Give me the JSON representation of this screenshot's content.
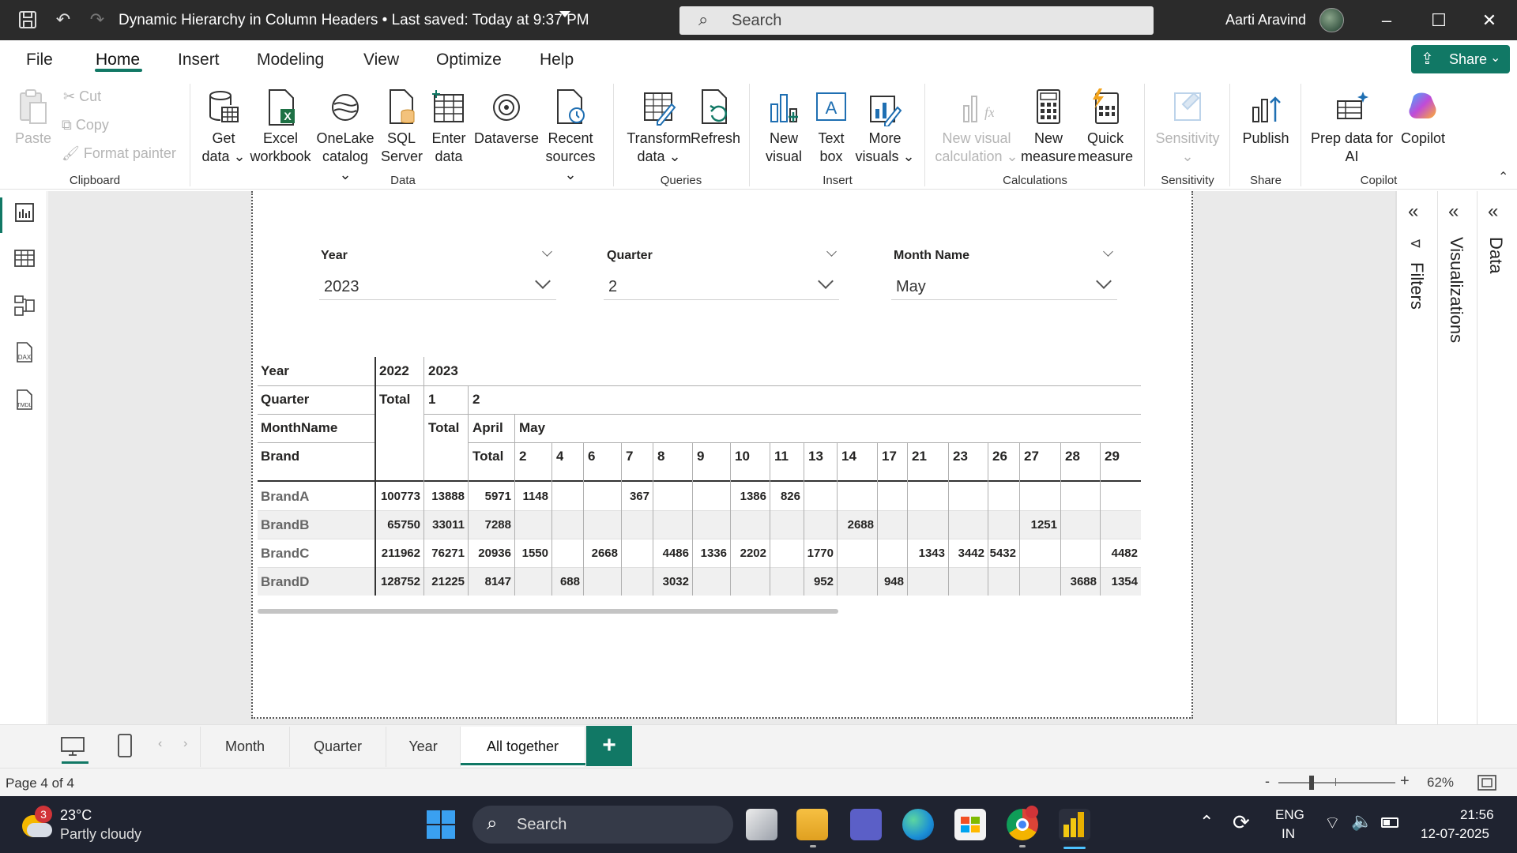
{
  "titlebar": {
    "doc_title": "Dynamic Hierarchy in Column Headers • Last saved: Today at 9:37 PM",
    "search_placeholder": "Search",
    "user_name": "Aarti Aravind"
  },
  "menu": {
    "items": [
      "File",
      "Home",
      "Insert",
      "Modeling",
      "View",
      "Optimize",
      "Help"
    ],
    "active": "Home",
    "share_label": "Share"
  },
  "ribbon": {
    "clipboard": {
      "paste": "Paste",
      "cut": "Cut",
      "copy": "Copy",
      "format_painter": "Format painter",
      "group": "Clipboard"
    },
    "data": {
      "get_data": [
        "Get",
        "data ⌄"
      ],
      "excel": [
        "Excel",
        "workbook"
      ],
      "onelake": [
        "OneLake",
        "catalog ⌄"
      ],
      "sql": [
        "SQL",
        "Server"
      ],
      "enter": [
        "Enter",
        "data"
      ],
      "dataverse": "Dataverse",
      "recent": [
        "Recent",
        "sources ⌄"
      ],
      "group": "Data"
    },
    "queries": {
      "transform": [
        "Transform",
        "data ⌄"
      ],
      "refresh": "Refresh",
      "group": "Queries"
    },
    "insert": {
      "new_visual": [
        "New",
        "visual"
      ],
      "text_box": [
        "Text",
        "box"
      ],
      "more_visuals": [
        "More",
        "visuals ⌄"
      ],
      "group": "Insert"
    },
    "calculations": {
      "new_visual_calc": [
        "New visual",
        "calculation ⌄"
      ],
      "new_measure": [
        "New",
        "measure"
      ],
      "quick_measure": [
        "Quick",
        "measure"
      ],
      "group": "Calculations"
    },
    "sensitivity": {
      "label": [
        "Sensitivity",
        "⌄"
      ],
      "group": "Sensitivity"
    },
    "share": {
      "publish": "Publish",
      "group": "Share"
    },
    "copilot": {
      "prep": [
        "Prep data for",
        "AI"
      ],
      "copilot": "Copilot",
      "group": "Copilot"
    }
  },
  "slicers": [
    {
      "label": "Year",
      "value": "2023"
    },
    {
      "label": "Quarter",
      "value": "2"
    },
    {
      "label": "Month Name",
      "value": "May"
    }
  ],
  "matrix": {
    "row_header_labels": [
      "Year",
      "Quarter",
      "MonthName",
      "Brand"
    ],
    "header_year": [
      "2022",
      "2023"
    ],
    "header_quarter": [
      "Total",
      "1",
      "2"
    ],
    "header_month": [
      "Total",
      "April",
      "May"
    ],
    "header_day": [
      "Total",
      "2",
      "4",
      "6",
      "7",
      "8",
      "9",
      "10",
      "11",
      "13",
      "14",
      "17",
      "21",
      "23",
      "26",
      "27",
      "28",
      "29"
    ],
    "rows": [
      {
        "brand": "BrandA",
        "cells": [
          "100773",
          "13888",
          "5971",
          "1148",
          "",
          "",
          "367",
          "",
          "",
          "1386",
          "826",
          "",
          "",
          "",
          "",
          "",
          "",
          "",
          "",
          ""
        ]
      },
      {
        "brand": "BrandB",
        "cells": [
          "65750",
          "33011",
          "7288",
          "",
          "",
          "",
          "",
          "",
          "",
          "",
          "",
          "",
          "2688",
          "",
          "",
          "",
          "",
          "1251",
          "",
          ""
        ]
      },
      {
        "brand": "BrandC",
        "cells": [
          "211962",
          "76271",
          "20936",
          "1550",
          "",
          "2668",
          "",
          "4486",
          "1336",
          "2202",
          "",
          "1770",
          "",
          "",
          "1343",
          "3442",
          "5432",
          "",
          "",
          "4482"
        ]
      },
      {
        "brand": "BrandD",
        "cells": [
          "128752",
          "21225",
          "8147",
          "",
          "688",
          "",
          "",
          "3032",
          "",
          "",
          "",
          "952",
          "",
          "948",
          "",
          "",
          "",
          "",
          "3688",
          "1354"
        ]
      }
    ]
  },
  "panes": {
    "filters": "Filters",
    "visualizations": "Visualizations",
    "data": "Data"
  },
  "page_tabs": {
    "tabs": [
      "Month",
      "Quarter",
      "Year",
      "All together"
    ],
    "active": "All together",
    "add": "+"
  },
  "status": {
    "page": "Page 4 of 4",
    "zoom": "62%"
  },
  "taskbar": {
    "weather_temp": "23°C",
    "weather_desc": "Partly cloudy",
    "weather_badge": "3",
    "search": "Search",
    "lang1": "ENG",
    "lang2": "IN",
    "time": "21:56",
    "date": "12-07-2025"
  },
  "colors": {
    "accent": "#117865",
    "titlebar": "#2b2b2b",
    "taskbar": "#1f2330"
  }
}
